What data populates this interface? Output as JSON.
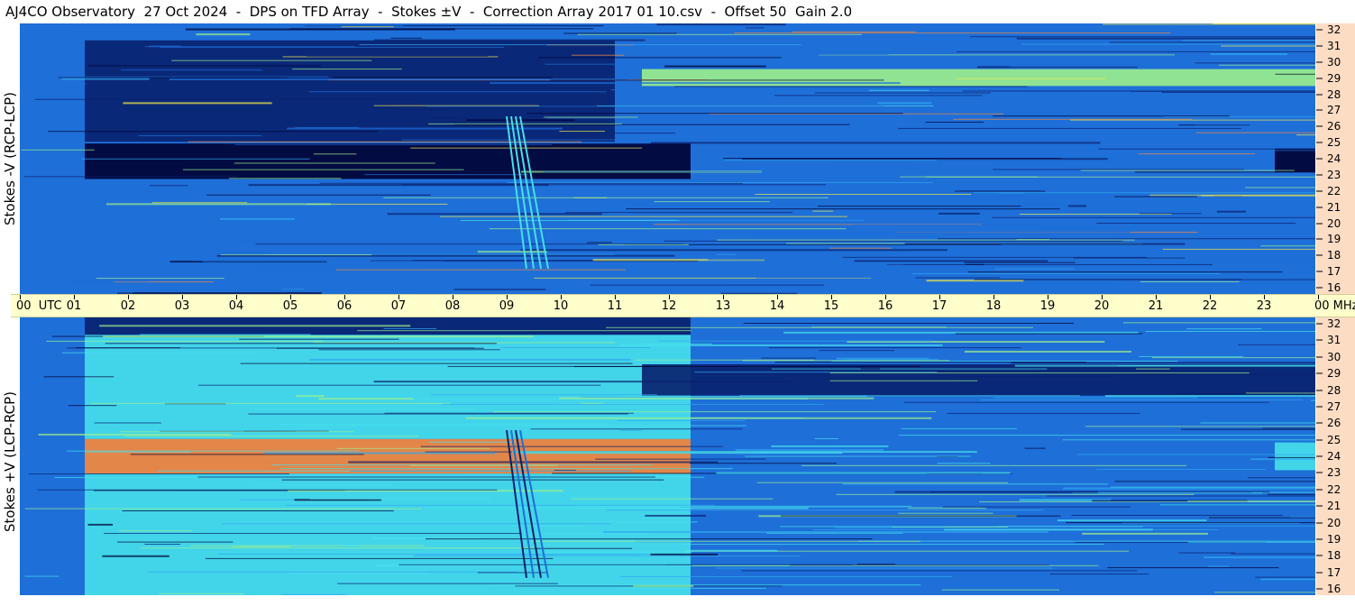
{
  "title": "AJ4CO Observatory  27 Oct 2024  -  DPS on TFD Array  -  Stokes ±V  -  Correction Array 2017 01 10.csv  -  Offset 50  Gain 2.0",
  "colors": {
    "background": "#ffffff",
    "axis_strip": "#ffffcc",
    "scale_strip": "#fddcc4",
    "colormap": [
      "#000033",
      "#08206e",
      "#1e6fd8",
      "#2fa8ef",
      "#46e0ec",
      "#9cf08c",
      "#f2e94a",
      "#f7883a",
      "#e8479a"
    ]
  },
  "chart_data": [
    {
      "type": "heatmap",
      "name": "top-panel",
      "ylabel": "Stokes -V (RCP-LCP)",
      "y_unit": "MHz",
      "ylim": [
        16,
        32
      ],
      "y_ticks": [
        32,
        31,
        30,
        29,
        28,
        27,
        26,
        25,
        24,
        23,
        22,
        21,
        20,
        19,
        18,
        17,
        16
      ],
      "x_unit": "UTC",
      "xlim": [
        0,
        24
      ],
      "x_ticks": [
        "00",
        "01",
        "02",
        "03",
        "04",
        "05",
        "06",
        "07",
        "08",
        "09",
        "10",
        "11",
        "12",
        "13",
        "14",
        "15",
        "16",
        "17",
        "18",
        "19",
        "20",
        "21",
        "22",
        "23",
        "00"
      ],
      "levels_description": "dark/negative day band 01–12.4 UTC with near-black band at 23–25 MHz; bright interference near 28–29 MHz after 11 UTC",
      "features": [
        {
          "kind": "band",
          "t_start": 1.2,
          "t_end": 12.4,
          "f_low": 22.8,
          "f_high": 24.9,
          "level": 0.0
        },
        {
          "kind": "band",
          "t_start": 1.2,
          "t_end": 11.0,
          "f_low": 25.0,
          "f_high": 31.0,
          "level": 0.12
        },
        {
          "kind": "band",
          "t_start": 1.2,
          "t_end": 12.4,
          "f_low": 16.0,
          "f_high": 22.8,
          "level": 0.22
        },
        {
          "kind": "band",
          "t_start": 23.2,
          "t_end": 24.0,
          "f_low": 23.2,
          "f_high": 24.6,
          "level": 0.05
        },
        {
          "kind": "band",
          "t_start": 11.5,
          "t_end": 24.0,
          "f_low": 28.3,
          "f_high": 29.3,
          "level": 0.6
        },
        {
          "kind": "burst",
          "t_start": 9.0,
          "t_end": 9.3,
          "f_low": 17.5,
          "f_high": 26.5,
          "level": 0.5
        }
      ]
    },
    {
      "type": "heatmap",
      "name": "bottom-panel",
      "ylabel": "Stokes +V (LCP-RCP)",
      "y_unit": "MHz",
      "ylim": [
        16,
        32
      ],
      "y_ticks": [
        32,
        31,
        30,
        29,
        28,
        27,
        26,
        25,
        24,
        23,
        22,
        21,
        20,
        19,
        18,
        17,
        16
      ],
      "x_unit": "UTC",
      "xlim": [
        0,
        24
      ],
      "levels_description": "bright/positive day band 01–12.4 UTC with strong red-yellow band at 23–25 MHz; dark interference near 28–29 MHz after 11 UTC",
      "features": [
        {
          "kind": "band",
          "t_start": 1.2,
          "t_end": 12.4,
          "f_low": 23.0,
          "f_high": 25.0,
          "level": 0.9
        },
        {
          "kind": "band",
          "t_start": 1.2,
          "t_end": 12.4,
          "f_low": 25.0,
          "f_high": 31.0,
          "level": 0.5
        },
        {
          "kind": "band",
          "t_start": 1.2,
          "t_end": 12.4,
          "f_low": 16.0,
          "f_high": 23.0,
          "level": 0.45
        },
        {
          "kind": "band",
          "t_start": 1.2,
          "t_end": 12.4,
          "f_low": 31.0,
          "f_high": 32.0,
          "level": 0.1
        },
        {
          "kind": "band",
          "t_start": 23.2,
          "t_end": 24.0,
          "f_low": 23.2,
          "f_high": 24.8,
          "level": 0.55
        },
        {
          "kind": "band",
          "t_start": 11.5,
          "t_end": 24.0,
          "f_low": 27.5,
          "f_high": 29.3,
          "level": 0.12
        },
        {
          "kind": "burst",
          "t_start": 9.0,
          "t_end": 9.3,
          "f_low": 17.0,
          "f_high": 25.5,
          "level": 0.2
        }
      ]
    }
  ],
  "time_axis": {
    "labels": [
      "00  UTC",
      "01",
      "02",
      "03",
      "04",
      "05",
      "06",
      "07",
      "08",
      "09",
      "10",
      "11",
      "12",
      "13",
      "14",
      "15",
      "16",
      "17",
      "18",
      "19",
      "20",
      "21",
      "22",
      "23",
      "00 MHz"
    ]
  }
}
